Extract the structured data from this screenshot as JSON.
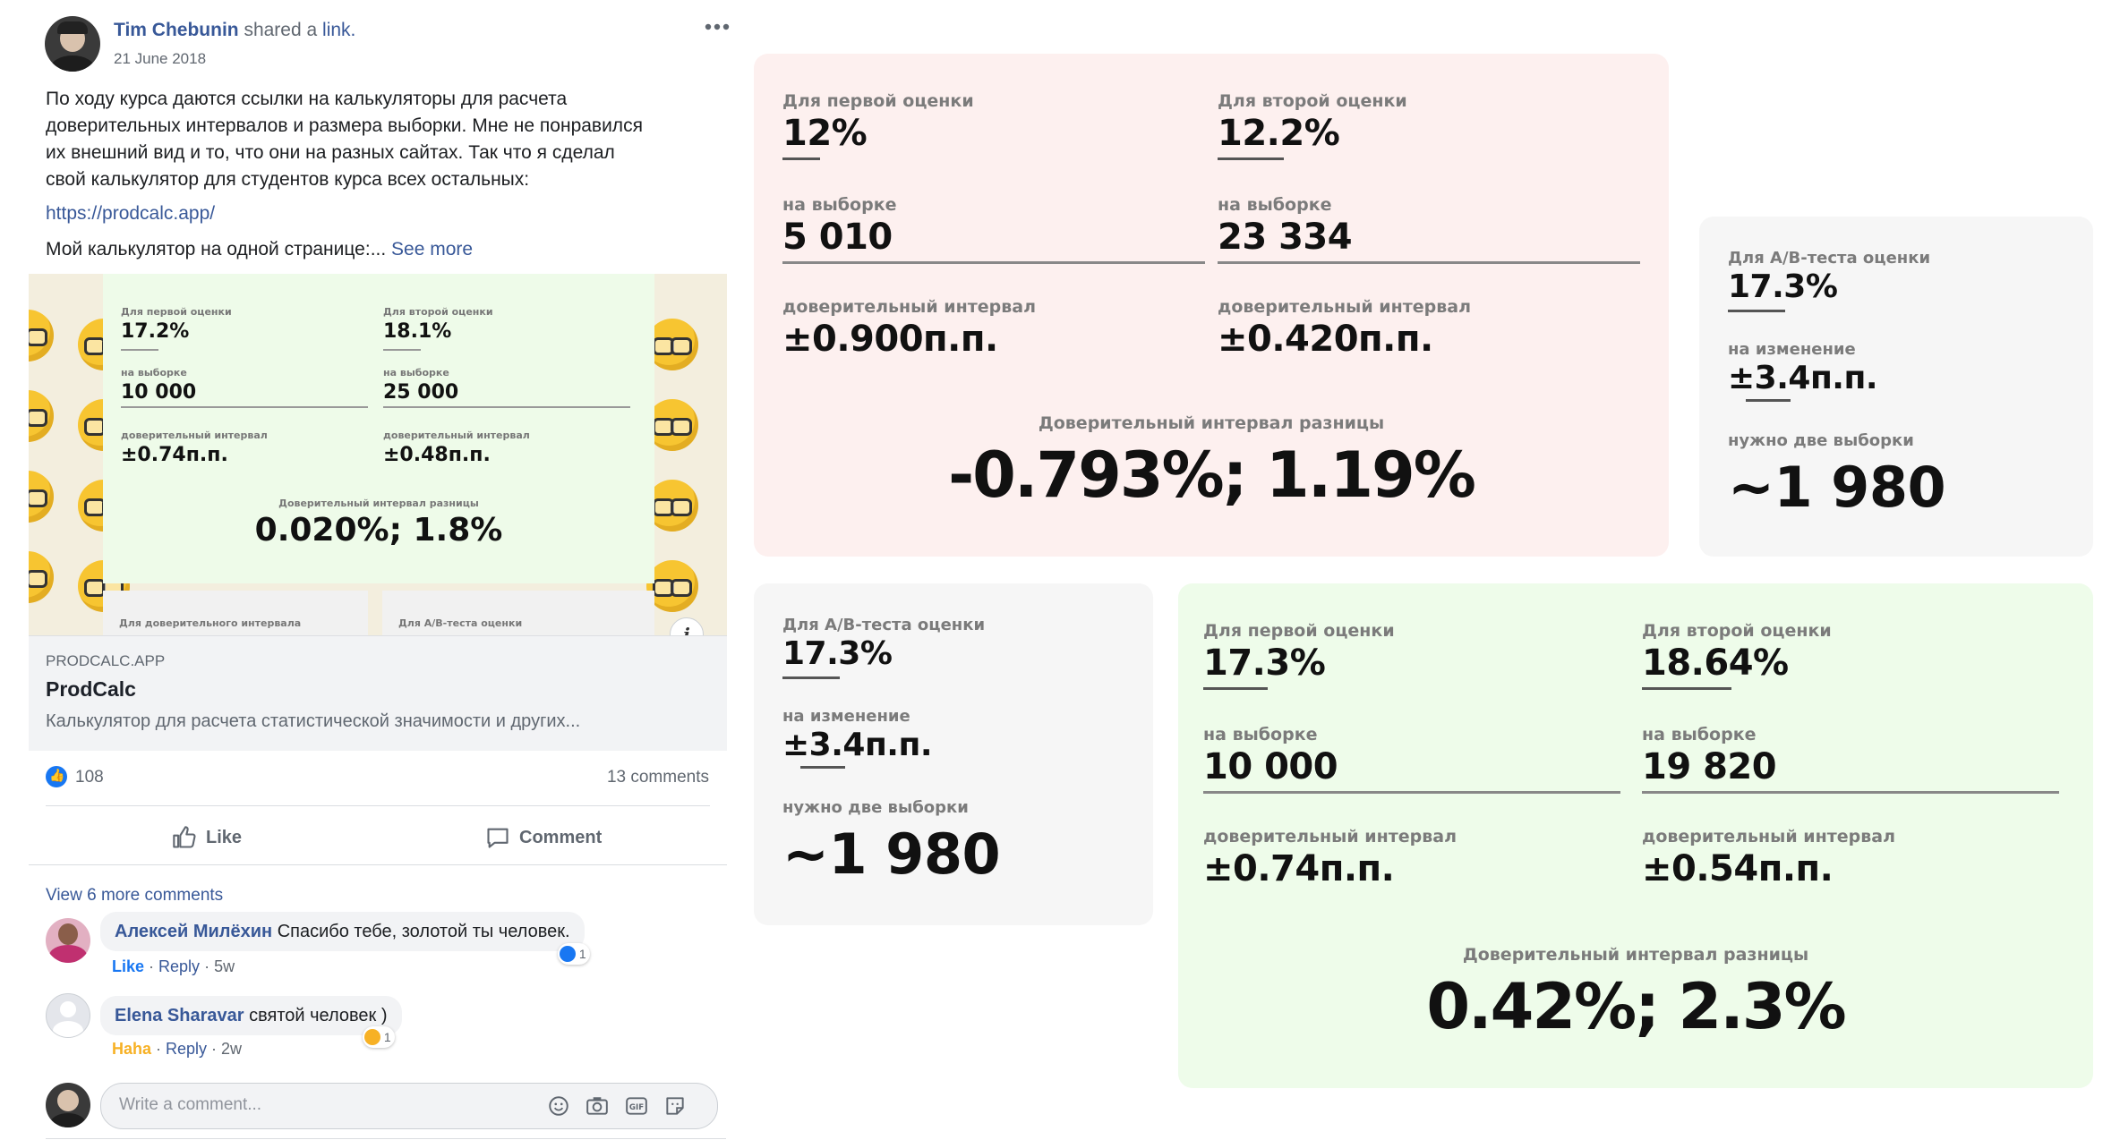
{
  "post": {
    "author": "Tim Chebunin",
    "action_text": "shared a",
    "action_link": "link.",
    "date": "21 June 2018",
    "more_icon": "more-options-icon",
    "body_lines": [
      "По ходу курса даются ссылки на калькуляторы для расчета",
      "доверительных интервалов и размера выборки. Мне не понравился",
      "их внешний вид и то, что они на разных сайтах. Так что я сделал",
      "свой калькулятор для студентов курса всех остальных:"
    ],
    "url": "https://prodcalc.app/",
    "summary": "Мой калькулятор на одной странице:...",
    "see_more": "See more"
  },
  "preview": {
    "mini": {
      "first_label": "Для первой оценки",
      "first_value": "17.2%",
      "second_label": "Для второй оценки",
      "second_value": "18.1%",
      "sample_label_1": "на выборке",
      "sample_value_1": "10 000",
      "sample_label_2": "на выборке",
      "sample_value_2": "25 000",
      "ci_label_1": "доверительный интервал",
      "ci_value_1": "±0.74п.п.",
      "ci_label_2": "доверительный интервал",
      "ci_value_2": "±0.48п.п.",
      "diff_label": "Доверительный интервал разницы",
      "diff_value": "0.020%; 1.8%",
      "bottom_left_label": "Для доверительного интервала",
      "bottom_right_label": "Для А/В-теста оценки"
    },
    "info_icon": "info-icon"
  },
  "link_card": {
    "domain": "PRODCALC.APP",
    "title": "ProdCalc",
    "description": "Калькулятор для расчета статистической значимости и других..."
  },
  "stats": {
    "likes": "108",
    "comments": "13 comments"
  },
  "actions": {
    "like": "Like",
    "comment": "Comment"
  },
  "comments": {
    "view_more": "View 6 more comments",
    "items": [
      {
        "name": "Алексей Милёхин",
        "text": "Спасибо тебе, золотой ты человек.",
        "reaction_label": "Like",
        "reply": "Reply",
        "age": "5w",
        "reaction_count": "1"
      },
      {
        "name": "Elena Sharavar",
        "text": "святой человек )",
        "reaction_label": "Haha",
        "reply": "Reply",
        "age": "2w",
        "reaction_count": "1"
      }
    ],
    "input_placeholder": "Write a comment...",
    "input_icons": [
      "emoji-icon",
      "camera-icon",
      "gif-icon",
      "sticker-icon"
    ]
  },
  "calc_pink": {
    "first_label": "Для первой оценки",
    "first_value": "12%",
    "second_label": "Для второй оценки",
    "second_value": "12.2%",
    "sample_label_1": "на выборке",
    "sample_value_1": "5 010",
    "sample_label_2": "на выборке",
    "sample_value_2": "23 334",
    "ci_label_1": "доверительный интервал",
    "ci_value_1": "±0.900п.п.",
    "ci_label_2": "доверительный интервал",
    "ci_value_2": "±0.420п.п.",
    "diff_label": "Доверительный интервал разницы",
    "diff_value": "-0.793%; 1.19%"
  },
  "calc_ab_right": {
    "label": "Для А/В-теста оценки",
    "value": "17.3%",
    "change_label": "на изменение",
    "change_value": "±3.4п.п.",
    "need_label": "нужно две выборки",
    "need_value": "~1 980"
  },
  "calc_ab_left": {
    "label": "Для А/В-теста оценки",
    "value": "17.3%",
    "change_label": "на изменение",
    "change_value": "±3.4п.п.",
    "need_label": "нужно две выборки",
    "need_value": "~1 980"
  },
  "calc_green": {
    "first_label": "Для первой оценки",
    "first_value": "17.3%",
    "second_label": "Для второй оценки",
    "second_value": "18.64%",
    "sample_label_1": "на выборке",
    "sample_value_1": "10 000",
    "sample_label_2": "на выборке",
    "sample_value_2": "19 820",
    "ci_label_1": "доверительный интервал",
    "ci_value_1": "±0.74п.п.",
    "ci_label_2": "доверительный интервал",
    "ci_value_2": "±0.54п.п.",
    "diff_label": "Доверительный интервал разницы",
    "diff_value": "0.42%; 2.3%"
  },
  "colors": {
    "pink_card": "#fdf0ef",
    "green_card": "#eefcea",
    "gray_card": "#f6f6f6",
    "fb_link": "#385898",
    "fb_blue": "#1877f2",
    "haha": "#f7b125"
  }
}
